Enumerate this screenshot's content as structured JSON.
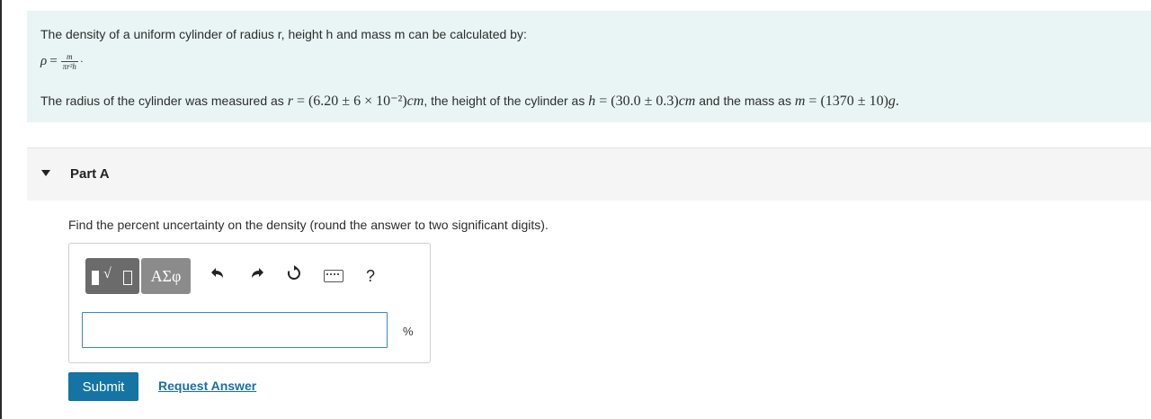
{
  "intro": {
    "statement": "The density of a uniform cylinder of radius r, height h and mass m can be calculated by:",
    "formula": {
      "lhs": "ρ",
      "equals": "=",
      "numerator": "m",
      "denominator": "πr²h",
      "end": "·"
    },
    "measurements": {
      "prefix": "The radius of the cylinder was measured as ",
      "r_symbol": "r",
      "r_value": "(6.20 ± 6 × 10⁻²)",
      "r_unit": "cm",
      "middle": ", the height of the cylinder as ",
      "h_symbol": "h",
      "h_value": "(30.0 ± 0.3)",
      "h_unit": "cm",
      "and_mass": " and the mass as ",
      "m_symbol": "m",
      "m_value": "(1370 ± 10)",
      "m_unit": "g",
      "end": "."
    },
    "equals": " = "
  },
  "part": {
    "title": "Part A"
  },
  "question": "Find the percent uncertainty on the density (round the answer to two significant digits).",
  "toolbar": {
    "greek_label": "ΑΣφ",
    "templates_icon": "templates-icon",
    "undo_icon": "undo-icon",
    "redo_icon": "redo-icon",
    "reset_icon": "reset-icon",
    "keyboard_icon": "keyboard-icon",
    "help_label": "?"
  },
  "answer": {
    "value": "",
    "unit": "%"
  },
  "actions": {
    "submit_label": "Submit",
    "request_label": "Request Answer"
  },
  "colors": {
    "intro_bg": "#e8f5f4",
    "submit_bg": "#1474a4",
    "link": "#1a6ea8",
    "input_border": "#3a86c8"
  }
}
